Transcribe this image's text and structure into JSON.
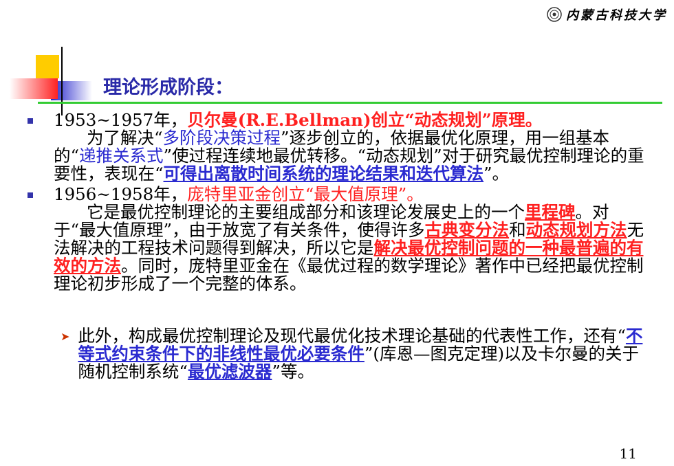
{
  "header": {
    "university_logo_text": "内蒙古科技大学"
  },
  "slide": {
    "title": "理论形成阶段：",
    "page_number": "11",
    "bullet1": {
      "years": "1953~1957年，",
      "headline": "贝尔曼(R.E.Bellman)创立“动态规划”原理。",
      "t1": "为了解决“",
      "t2": "多阶段决策过程",
      "t3": "”逐步创立的，依据最优化原理，用一组基本的“",
      "t4": "递推关系式",
      "t5": "”使过程连续地最优转移。“动态规划”对于研究最优控制理论的重要性，表现在“",
      "t6": "可得出离散时间系统的理论结果和迭代算法",
      "t7": "”。"
    },
    "bullet2": {
      "years": "1956~1958年，",
      "headline": "庞特里亚金创立“最大值原理”。",
      "t1": "它是最优控制理论的主要组成部分和该理论发展史上的一个",
      "t2": "里程碑",
      "t3": "。对于“最大值原理”，由于放宽了有关条件，使得许多",
      "t4": "古典变分法",
      "t5": "和",
      "t6": "动态规划方法",
      "t7": "无法解决的工程技术问题得到解决，所以它是",
      "t8": "解决最优控制问题的一种最普遍的有效的方法",
      "t9": "。同时，庞特里亚金在《最优过程的数学理论》著作中已经把最优控制理论初步形成了一个完整的体系。"
    },
    "sub_bullet": {
      "t1": "此外，构成最优控制理论及现代最优化技术理论基础的代表性工作，还有“",
      "t2": "不等式约束条件下的非线性最优必要条件",
      "t3": "”(库恩—图克定理)以及卡尔曼的关于随机控制系统“",
      "t4": "最优滤波器",
      "t5": "”等。"
    }
  },
  "colors": {
    "title": "#2a2aa8",
    "red": "#ff2020",
    "blue": "#2a2ad0",
    "rule": "#33cc33"
  }
}
